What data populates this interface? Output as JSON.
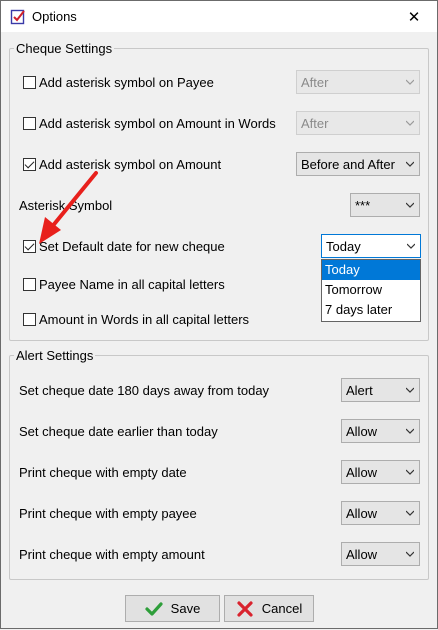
{
  "window": {
    "title": "Options",
    "close_glyph": "✕"
  },
  "cheque_settings": {
    "legend": "Cheque Settings",
    "rows": [
      {
        "label": "Add asterisk symbol on Payee",
        "checked": false,
        "select_value": "After",
        "select_disabled": true
      },
      {
        "label": "Add asterisk symbol on Amount in Words",
        "checked": false,
        "select_value": "After",
        "select_disabled": true
      },
      {
        "label": "Add asterisk symbol on Amount",
        "checked": true,
        "select_value": "Before and After",
        "select_disabled": false
      }
    ],
    "asterisk_symbol": {
      "label": "Asterisk Symbol",
      "select_value": "***"
    },
    "default_date": {
      "label": "Set Default date for new cheque",
      "checked": true,
      "select_value": "Today",
      "options": [
        "Today",
        "Tomorrow",
        "7 days later"
      ],
      "highlighted_option": "Today"
    },
    "payee_caps": {
      "label": "Payee Name in all capital letters",
      "checked": false
    },
    "words_caps": {
      "label": "Amount in Words in all capital letters",
      "checked": false
    }
  },
  "alert_settings": {
    "legend": "Alert Settings",
    "rows": [
      {
        "label": "Set cheque date 180 days away from today",
        "select_value": "Alert"
      },
      {
        "label": "Set cheque date earlier than today",
        "select_value": "Allow"
      },
      {
        "label": "Print cheque with empty date",
        "select_value": "Allow"
      },
      {
        "label": "Print cheque with empty payee",
        "select_value": "Allow"
      },
      {
        "label": "Print cheque with empty amount",
        "select_value": "Allow"
      }
    ]
  },
  "buttons": {
    "save_label": "Save",
    "cancel_label": "Cancel"
  },
  "colors": {
    "accent": "#0078d7",
    "annotation_arrow": "#e8201c",
    "save_icon": "#2e9e3a",
    "cancel_icon": "#d9232e"
  }
}
